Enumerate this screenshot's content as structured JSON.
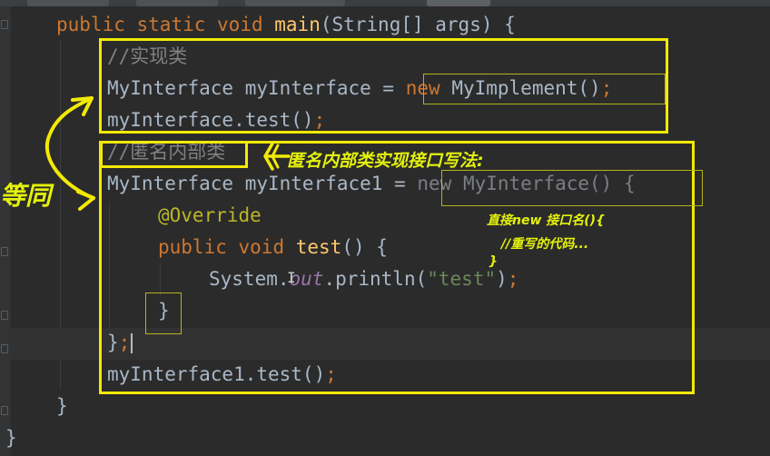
{
  "code": {
    "main_line": {
      "kw1": "public",
      "kw2": "static",
      "kw3": "void",
      "name": "main",
      "params": "(String[] args) {"
    },
    "comment1": "//实现类",
    "decl1": {
      "text": "MyInterface myInterface = ",
      "new_kw": "new",
      "ctor": " MyImplement()",
      "semi": ";"
    },
    "call1": {
      "text": "myInterface.test()",
      "semi": ";"
    },
    "comment2": "//匿名内部类",
    "decl2": {
      "text": "MyInterface myInterface1 = ",
      "new_part": "new MyInterface() {"
    },
    "override": "@Override",
    "method_line": {
      "kw1": "public",
      "kw2": "void",
      "name": "test",
      "rest": "() {"
    },
    "print_line": {
      "sys": "System.",
      "out": "out",
      "dot_println": ".println(",
      "str": "\"test\"",
      "end": ")",
      "semi": ";"
    },
    "close_inner": "}",
    "close_anon": {
      "brace": "}",
      "semi": ";"
    },
    "call2": {
      "text": "myInterface1.test()",
      "semi": ";"
    },
    "close_method": "}",
    "close_class": "}"
  },
  "annotations": {
    "equal_label": "等同",
    "title_note": "匿名内部类实现接口写法:",
    "syntax_note_1": "直接new 接口名(){",
    "syntax_note_2": "//重写的代码...",
    "syntax_note_3": "}"
  },
  "colors": {
    "background": "#2b2b2b",
    "keyword": "#cc7832",
    "method": "#ffc66d",
    "string": "#6a8759",
    "annotation": "#bbb529",
    "static_field": "#9876aa",
    "comment": "#808080",
    "highlight_box": "#f2ea05"
  }
}
